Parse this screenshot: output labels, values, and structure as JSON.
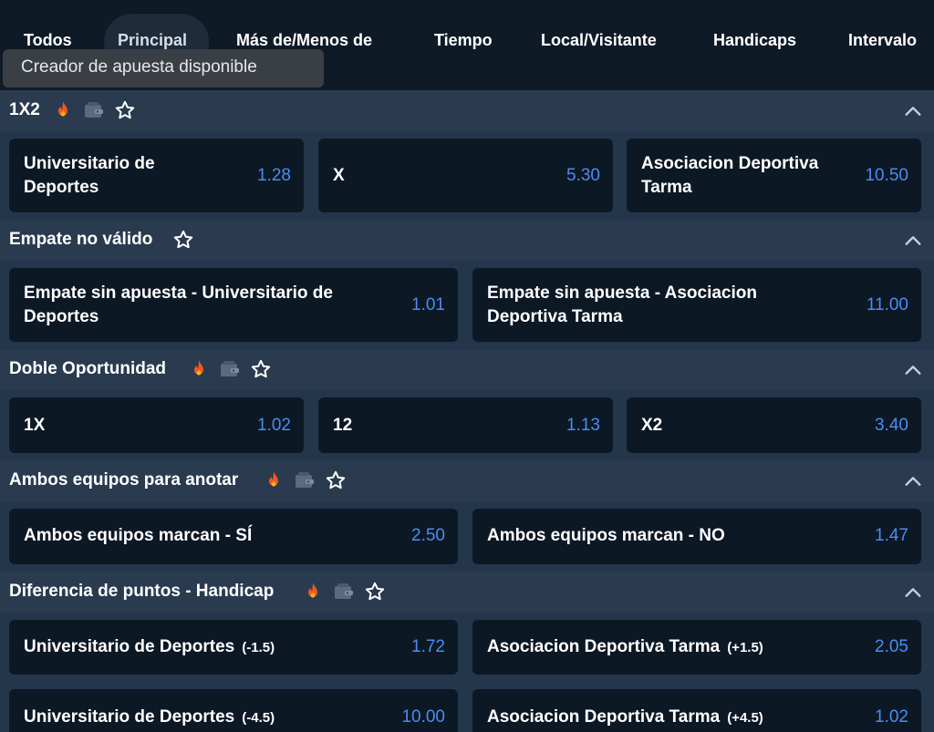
{
  "tabs": [
    "Todos",
    "Principal",
    "Más de/Menos de",
    "Tiempo",
    "Local/Visitante",
    "Handicaps",
    "Intervalo"
  ],
  "tooltip": "Creador de apuesta disponible",
  "colors": {
    "odds": "#4a8df0",
    "background": "#0f1a27",
    "section_header": "#2a3b4f",
    "cell": "#0d1825"
  },
  "icons": {
    "fire": "fire-icon",
    "wallet": "wallet-icon",
    "star": "star-icon",
    "collapse": "chevron-up-icon"
  },
  "sections": [
    {
      "title": "1X2",
      "cells": [
        {
          "label": "Universitario de Deportes",
          "odds": "1.28"
        },
        {
          "label": "X",
          "odds": "5.30"
        },
        {
          "label": "Asociacion Deportiva Tarma",
          "odds": "10.50"
        }
      ]
    },
    {
      "title": "Empate no válido",
      "cells": [
        {
          "label": "Empate sin apuesta - Universitario de Deportes",
          "odds": "1.01"
        },
        {
          "label": "Empate sin apuesta - Asociacion Deportiva Tarma",
          "odds": "11.00"
        }
      ]
    },
    {
      "title": "Doble Oportunidad",
      "cells": [
        {
          "label": "1X",
          "odds": "1.02"
        },
        {
          "label": "12",
          "odds": "1.13"
        },
        {
          "label": "X2",
          "odds": "3.40"
        }
      ]
    },
    {
      "title": "Ambos equipos para anotar",
      "cells": [
        {
          "label": "Ambos equipos marcan - SÍ",
          "odds": "2.50"
        },
        {
          "label": "Ambos equipos marcan - NO",
          "odds": "1.47"
        }
      ]
    },
    {
      "title": "Diferencia de puntos - Handicap",
      "cells": [
        {
          "label": "Universitario de Deportes",
          "handicap": "(-1.5)",
          "odds": "1.72"
        },
        {
          "label": "Asociacion Deportiva Tarma",
          "handicap": "(+1.5)",
          "odds": "2.05"
        },
        {
          "label": "Universitario de Deportes",
          "handicap": "(-4.5)",
          "odds": "10.00"
        },
        {
          "label": "Asociacion Deportiva Tarma",
          "handicap": "(+4.5)",
          "odds": "1.02"
        }
      ]
    }
  ]
}
